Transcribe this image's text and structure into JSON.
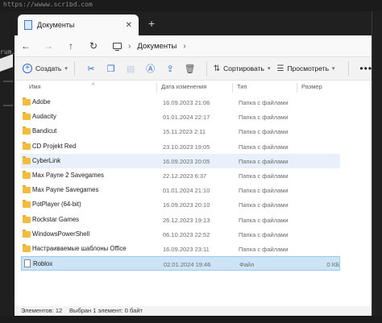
{
  "background": {
    "top_text": "https://wwww.scribd.com",
    "side_text": "rum.r"
  },
  "window": {
    "tab_title": "Документы",
    "tab_close": "✕",
    "new_tab": "+"
  },
  "nav": {
    "back": "←",
    "forward": "→",
    "up": "↑",
    "refresh": "↻",
    "breadcrumb": [
      "Документы"
    ],
    "crumb_sep": "›"
  },
  "toolbar": {
    "create_label": "Создать",
    "sort_label": "Сортировать",
    "view_label": "Просмотреть",
    "more": "•••"
  },
  "columns": {
    "name": "Имя",
    "date": "Дата изменения",
    "type": "Тип",
    "size": "Размер"
  },
  "rows": [
    {
      "name": "Adobe",
      "date": "16.09.2023 21:06",
      "type": "Папка с файлами",
      "size": "",
      "kind": "folder"
    },
    {
      "name": "Audacity",
      "date": "01.01.2024 22:17",
      "type": "Папка с файлами",
      "size": "",
      "kind": "folder"
    },
    {
      "name": "Bandicut",
      "date": "15.11.2023 2:11",
      "type": "Папка с файлами",
      "size": "",
      "kind": "folder"
    },
    {
      "name": "CD Projekt Red",
      "date": "23.10.2023 19:05",
      "type": "Папка с файлами",
      "size": "",
      "kind": "folder"
    },
    {
      "name": "CyberLink",
      "date": "16.09.2023 20:05",
      "type": "Папка с файлами",
      "size": "",
      "kind": "folder"
    },
    {
      "name": "Max Payne 2 Savegames",
      "date": "22.12.2023 6:37",
      "type": "Папка с файлами",
      "size": "",
      "kind": "folder"
    },
    {
      "name": "Max Payne Savegames",
      "date": "01.01.2024 21:10",
      "type": "Папка с файлами",
      "size": "",
      "kind": "folder"
    },
    {
      "name": "PotPlayer (64-bit)",
      "date": "16.09.2023 20:10",
      "type": "Папка с файлами",
      "size": "",
      "kind": "folder"
    },
    {
      "name": "Rockstar Games",
      "date": "26.12.2023 19:13",
      "type": "Папка с файлами",
      "size": "",
      "kind": "folder"
    },
    {
      "name": "WindowsPowerShell",
      "date": "06.10.2023 22:52",
      "type": "Папка с файлами",
      "size": "",
      "kind": "folder"
    },
    {
      "name": "Настраиваемые шаблоны Office",
      "date": "16.09.2023 23:11",
      "type": "Папка с файлами",
      "size": "",
      "kind": "folder"
    },
    {
      "name": "Roblox",
      "date": "02.01.2024 19:46",
      "type": "Файл",
      "size": "0 КБ",
      "kind": "file"
    }
  ],
  "status": {
    "count": "Элементов: 12",
    "selected": "Выбран 1 элемент: 0 байт"
  },
  "colors": {
    "accent": "#2b6ad1",
    "selection": "#cde4f7",
    "folder": "#f2bd3f"
  }
}
